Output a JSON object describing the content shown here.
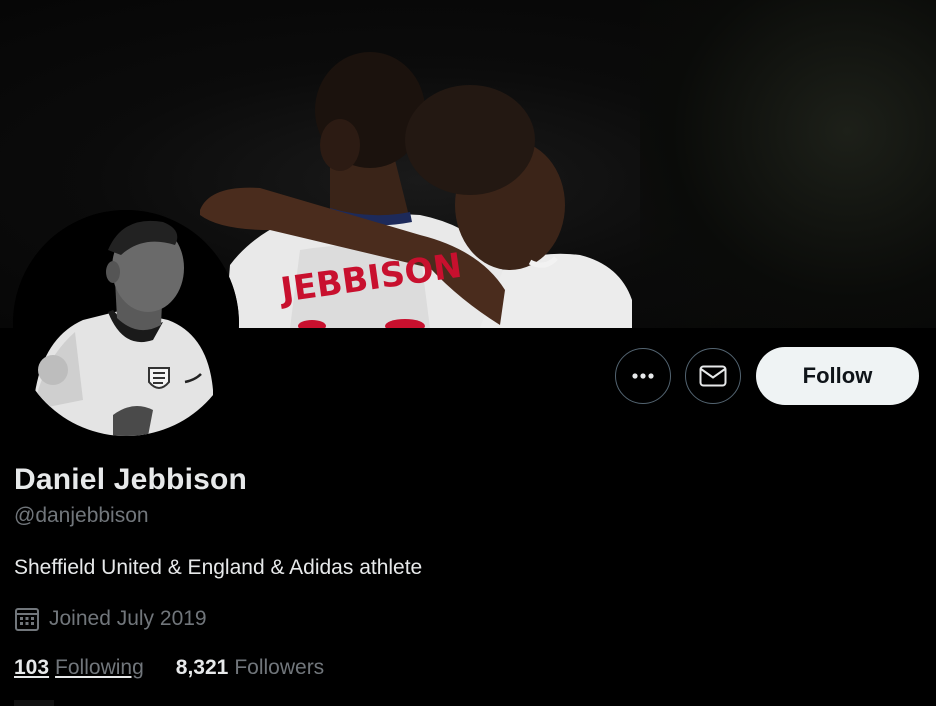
{
  "profile": {
    "display_name": "Daniel Jebbison",
    "handle": "@danjebbison",
    "bio": "Sheffield United & England & Adidas athlete",
    "joined": "Joined July 2019",
    "following_count": "103",
    "following_label": "Following",
    "followers_count": "8,321",
    "followers_label": "Followers"
  },
  "banner": {
    "jersey_text": "JEBBISON"
  },
  "actions": {
    "more_icon": "more-horizontal-icon",
    "message_icon": "envelope-icon",
    "follow_label": "Follow"
  },
  "icons": {
    "calendar": "calendar-icon"
  },
  "colors": {
    "background": "#000000",
    "primary_text": "#e7e9ea",
    "secondary_text": "#71767b",
    "follow_button_bg": "#eff3f4",
    "follow_button_text": "#0f1419",
    "jersey_text": "#c8102e"
  }
}
